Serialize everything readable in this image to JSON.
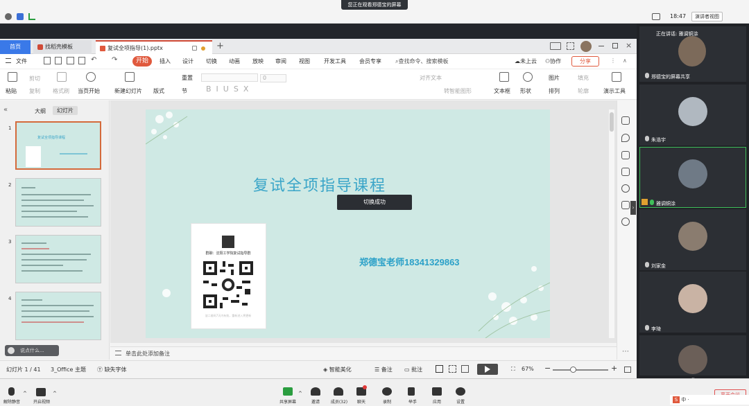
{
  "system": {
    "share_banner": "您正在观看郑德宝的屏幕",
    "clock": "18:47",
    "view_button": "演讲者视图"
  },
  "wps": {
    "tabs": [
      {
        "label": "首页"
      },
      {
        "label": "找稻壳模板"
      },
      {
        "label": "复试全项指导(1).pptx"
      }
    ],
    "tab_plus": "+",
    "file_menu": "文件",
    "menus": [
      "开始",
      "插入",
      "设计",
      "切换",
      "动画",
      "放映",
      "审阅",
      "视图",
      "开发工具",
      "会员专享"
    ],
    "search_placeholder": "查找命令、搜索模板",
    "cloud": "未上云",
    "collab": "协作",
    "share": "分享",
    "ribbon": {
      "paste": "粘贴",
      "cut": "剪切",
      "copy": "复制",
      "format_painter": "格式刷",
      "from_current": "当页开始",
      "new_slide": "新建幻灯片",
      "layout": "版式",
      "section": "节",
      "reset": "重置",
      "font_size": "0",
      "text_box": "文本框",
      "shape": "形状",
      "picture": "图片",
      "fill": "填充",
      "arrange": "排列",
      "outline": "轮廓",
      "presentation_tools": "演示工具",
      "align_text": "对齐文本",
      "smart_graphic": "转智能图形"
    },
    "panel_tabs": [
      "大纲",
      "幻灯片"
    ],
    "thumbs": [
      "1",
      "2",
      "3",
      "4"
    ],
    "thumb_title": "复试全项指导课程",
    "slide": {
      "title": "复试全项指导课程",
      "teacher": "郑德宝老师18341329863",
      "qr_caption": "群聊：沈阳工学院复试指导群",
      "qr_foot": "该二维码7天内有效，重新进入将更新"
    },
    "toast": "切换成功",
    "notes_placeholder": "单击此处添加备注",
    "chat_hint": "说点什么...",
    "status": {
      "slide_counter": "幻灯片 1 / 41",
      "theme": "3_Office 主题",
      "missing_font": "缺失字体",
      "smart_beautify": "智能美化",
      "notes": "备注",
      "comments": "批注",
      "zoom": "67%"
    }
  },
  "meeting": {
    "toolbar": [
      {
        "label": "解除静音",
        "icon": "mic-muted-icon"
      },
      {
        "label": "开启视频",
        "icon": "camera-off-icon"
      },
      {
        "label": "共享屏幕",
        "icon": "share-screen-icon"
      },
      {
        "label": "邀请",
        "icon": "invite-icon"
      },
      {
        "label": "成员(32)",
        "icon": "members-icon"
      },
      {
        "label": "聊天",
        "icon": "chat-icon"
      },
      {
        "label": "录制",
        "icon": "record-icon"
      },
      {
        "label": "举手",
        "icon": "hand-icon"
      },
      {
        "label": "应用",
        "icon": "apps-icon"
      },
      {
        "label": "设置",
        "icon": "settings-icon"
      }
    ],
    "ime": "中 ·",
    "speaking": "正在讲话: 雅调铜涂",
    "participants": [
      {
        "name": "郑德宝的屏幕共享",
        "color": "#7c6a5a"
      },
      {
        "name": "朱浩宇",
        "color": "#b0b8c0"
      },
      {
        "name": "雅调铜涂",
        "color": "#6f7a86"
      },
      {
        "name": "刘家金",
        "color": "#8a7c6f"
      },
      {
        "name": "李琦",
        "color": "#c9b3a4"
      },
      {
        "name": "",
        "color": "#6b5f58"
      }
    ],
    "end_meeting": "离开会议"
  }
}
